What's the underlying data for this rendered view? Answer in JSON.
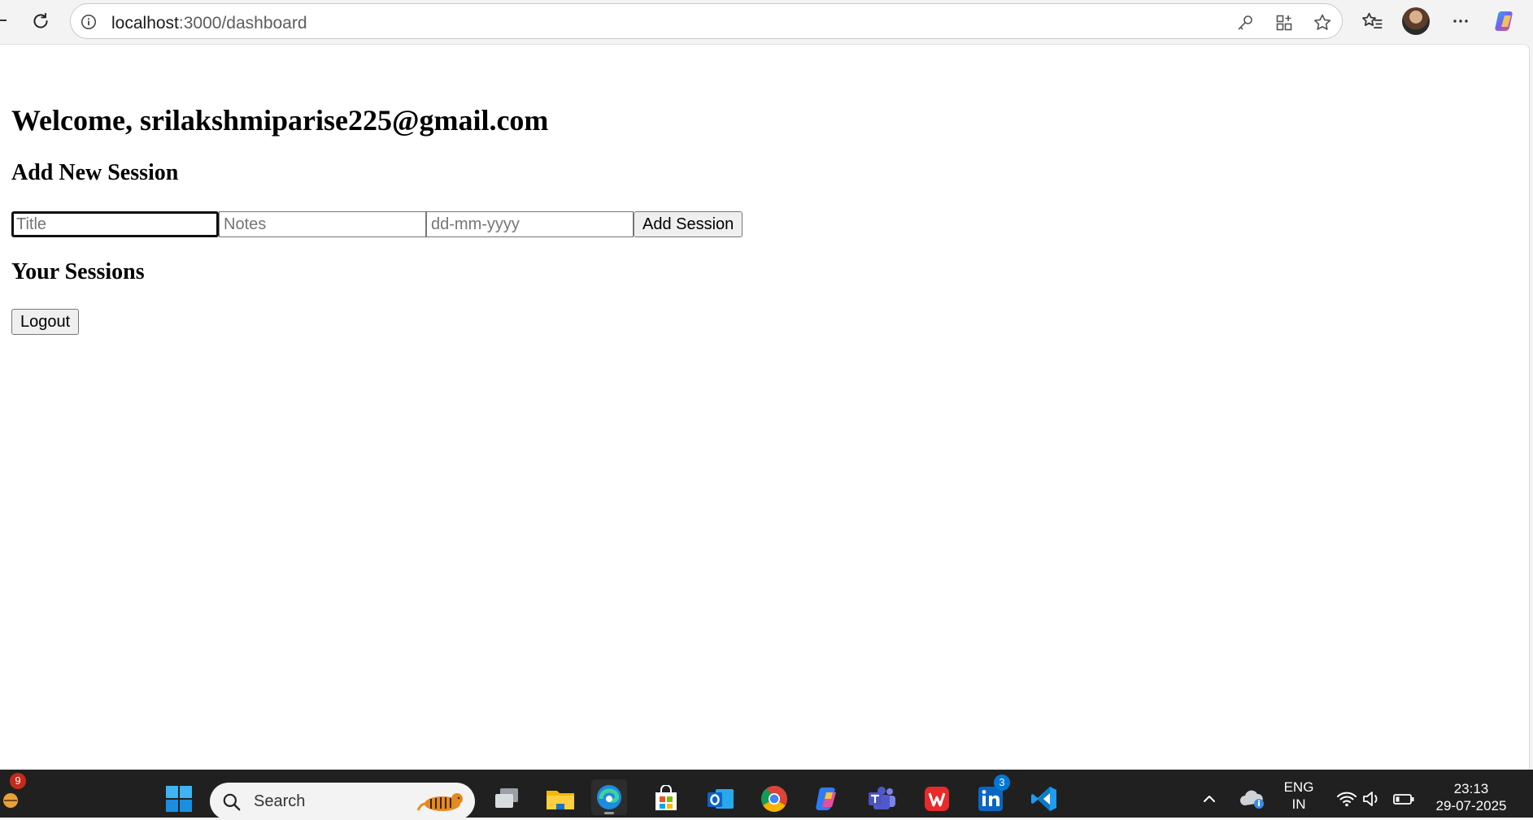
{
  "browser": {
    "url_host": "localhost",
    "url_path": ":3000/dashboard",
    "icons": [
      "back-icon",
      "reload-icon",
      "site-info-icon",
      "password-key-icon",
      "app-available-icon",
      "favorite-star-icon",
      "favorites-icon",
      "profile-avatar",
      "more-options-icon",
      "copilot-icon"
    ]
  },
  "page": {
    "welcome": "Welcome, srilakshmiparise225@gmail.com",
    "add_heading": "Add New Session",
    "form": {
      "title_placeholder": "Title",
      "notes_placeholder": "Notes",
      "date_placeholder": "dd-mm-yyyy",
      "title_value": "",
      "notes_value": "",
      "date_value": "",
      "submit_label": "Add Session"
    },
    "sessions_heading": "Your Sessions",
    "logout_label": "Logout"
  },
  "taskbar": {
    "widget_badge": "9",
    "search_label": "Search",
    "linkedin_badge": "3",
    "apps": [
      "windows-start",
      "search",
      "task-view",
      "file-explorer",
      "edge",
      "microsoft-store",
      "outlook",
      "chrome",
      "copilot",
      "teams",
      "wps-office",
      "linkedin",
      "vscode"
    ],
    "language_line1": "ENG",
    "language_line2": "IN",
    "time": "23:13",
    "date": "29-07-2025"
  },
  "colors": {
    "chrome_bg": "#f3f3f3",
    "page_bg": "#ffffff",
    "taskbar_bg": "#202020",
    "badge_red": "#c42b1c",
    "badge_blue": "#0078d4"
  }
}
